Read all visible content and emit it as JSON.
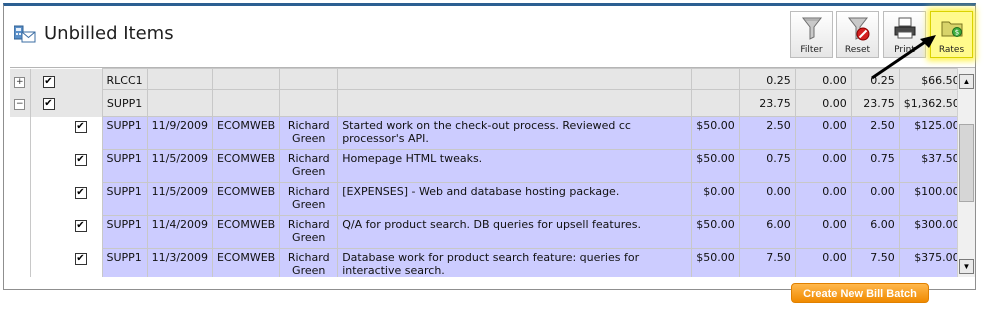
{
  "page": {
    "title": "Unbilled Items",
    "title_icon": "envelope-calculator-icon"
  },
  "toolbar": {
    "filter_label": "Filter",
    "reset_label": "Reset",
    "print_label": "Print",
    "rates_label": "Rates"
  },
  "grid": {
    "rows": [
      {
        "type": "summary",
        "expander": "+",
        "checked": true,
        "code": "RLCC1",
        "hours": "0.25",
        "nobill": "0.00",
        "bill": "0.25",
        "amount": "$66.50"
      },
      {
        "type": "summary",
        "expander": "−",
        "checked": true,
        "code": "SUPP1",
        "hours": "23.75",
        "nobill": "0.00",
        "bill": "23.75",
        "amount": "$1,362.50"
      },
      {
        "type": "item",
        "checked": true,
        "code": "SUPP1",
        "date": "11/9/2009",
        "client": "ECOMWEB",
        "employee": "Richard Green",
        "description": "Started work on the check-out process. Reviewed cc processor's API.",
        "rate": "$50.00",
        "hours": "2.50",
        "nobill": "0.00",
        "bill": "2.50",
        "amount": "$125.00"
      },
      {
        "type": "item",
        "checked": true,
        "code": "SUPP1",
        "date": "11/5/2009",
        "client": "ECOMWEB",
        "employee": "Richard Green",
        "description": "Homepage HTML tweaks.",
        "rate": "$50.00",
        "hours": "0.75",
        "nobill": "0.00",
        "bill": "0.75",
        "amount": "$37.50"
      },
      {
        "type": "item",
        "checked": true,
        "code": "SUPP1",
        "date": "11/5/2009",
        "client": "ECOMWEB",
        "employee": "Richard Green",
        "description": "[EXPENSES] - Web and database hosting package.",
        "rate": "$0.00",
        "hours": "0.00",
        "nobill": "0.00",
        "bill": "0.00",
        "amount": "$100.00"
      },
      {
        "type": "item",
        "checked": true,
        "code": "SUPP1",
        "date": "11/4/2009",
        "client": "ECOMWEB",
        "employee": "Richard Green",
        "description": "Q/A for product search. DB queries for upsell features.",
        "rate": "$50.00",
        "hours": "6.00",
        "nobill": "0.00",
        "bill": "6.00",
        "amount": "$300.00"
      },
      {
        "type": "item",
        "checked": true,
        "code": "SUPP1",
        "date": "11/3/2009",
        "client": "ECOMWEB",
        "employee": "Richard Green",
        "description": "Database work for product search feature: queries for interactive search.",
        "rate": "$50.00",
        "hours": "7.50",
        "nobill": "0.00",
        "bill": "7.50",
        "amount": "$375.00"
      }
    ]
  },
  "scrollbar": {
    "up_glyph": "▲",
    "down_glyph": "▼"
  },
  "actions": {
    "create_batch_label": "Create New Bill Batch"
  },
  "colors": {
    "item_row": "#ccccff",
    "summary_row": "#e6e6e6",
    "accent_border": "#2c5f92",
    "action_button": "#f08a00",
    "highlight": "#fffa8c"
  }
}
